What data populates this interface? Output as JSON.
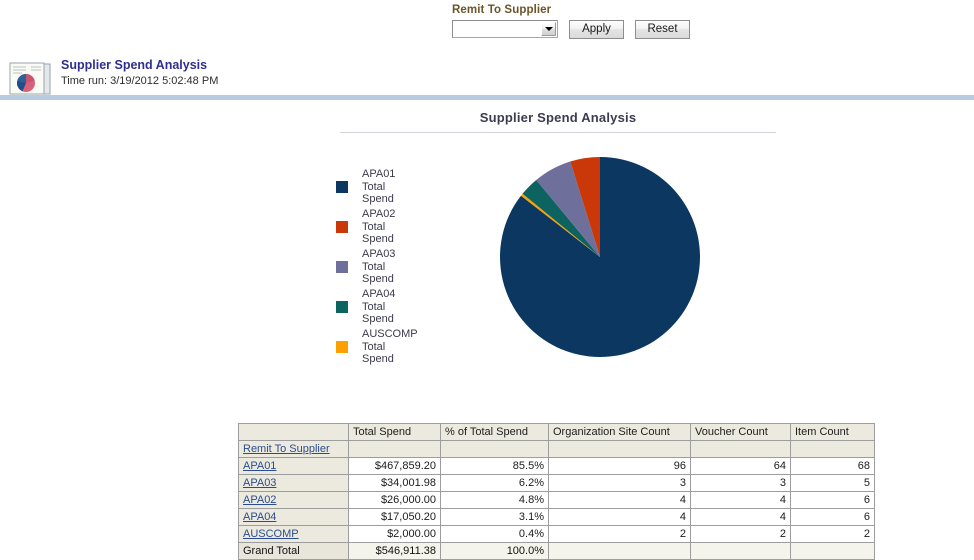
{
  "prompt": {
    "label": "Remit To Supplier",
    "dropdown_value": "",
    "dropdown_placeholder": "",
    "apply_label": "Apply",
    "reset_label": "Reset"
  },
  "report": {
    "title": "Supplier Spend Analysis",
    "timestamp": "Time run: 3/19/2012 5:02:48 PM",
    "icon": "pie-chart-report-icon"
  },
  "chart_data": {
    "type": "pie",
    "title": "Supplier Spend Analysis",
    "xlabel": "",
    "ylabel": "",
    "legend_position": "left",
    "categories": [
      "APA01 Total Spend",
      "APA02 Total Spend",
      "APA03 Total Spend",
      "APA04 Total Spend",
      "AUSCOMP Total Spend"
    ],
    "legend_labels": [
      "APA01\nTotal\nSpend",
      "APA02\nTotal\nSpend",
      "APA03\nTotal\nSpend",
      "APA04\nTotal\nSpend",
      "AUSCOMP\nTotal\nSpend"
    ],
    "values": [
      467859.2,
      26000.0,
      34001.98,
      17050.2,
      2000.0
    ],
    "percentages": [
      85.5,
      4.8,
      6.2,
      3.1,
      0.4
    ],
    "colors": [
      "#0b3761",
      "#ca3708",
      "#6e6f9b",
      "#0c6360",
      "#fca000"
    ],
    "total": 546911.38
  },
  "table": {
    "columns": [
      "",
      "Total Spend",
      "% of Total Spend",
      "Organization Site Count",
      "Voucher Count",
      "Item Count"
    ],
    "group_header": "Remit To Supplier",
    "rows": [
      {
        "label": "APA01",
        "total_spend": "$467,859.20",
        "pct": "85.5%",
        "org_site_count": "96",
        "voucher_count": "64",
        "item_count": "68"
      },
      {
        "label": "APA03",
        "total_spend": "$34,001.98",
        "pct": "6.2%",
        "org_site_count": "3",
        "voucher_count": "3",
        "item_count": "5"
      },
      {
        "label": "APA02",
        "total_spend": "$26,000.00",
        "pct": "4.8%",
        "org_site_count": "4",
        "voucher_count": "4",
        "item_count": "6"
      },
      {
        "label": "APA04",
        "total_spend": "$17,050.20",
        "pct": "3.1%",
        "org_site_count": "4",
        "voucher_count": "4",
        "item_count": "6"
      },
      {
        "label": "AUSCOMP",
        "total_spend": "$2,000.00",
        "pct": "0.4%",
        "org_site_count": "2",
        "voucher_count": "2",
        "item_count": "2"
      }
    ],
    "grand_total": {
      "label": "Grand Total",
      "total_spend": "$546,911.38",
      "pct": "100.0%",
      "org_site_count": "",
      "voucher_count": "",
      "item_count": ""
    }
  }
}
